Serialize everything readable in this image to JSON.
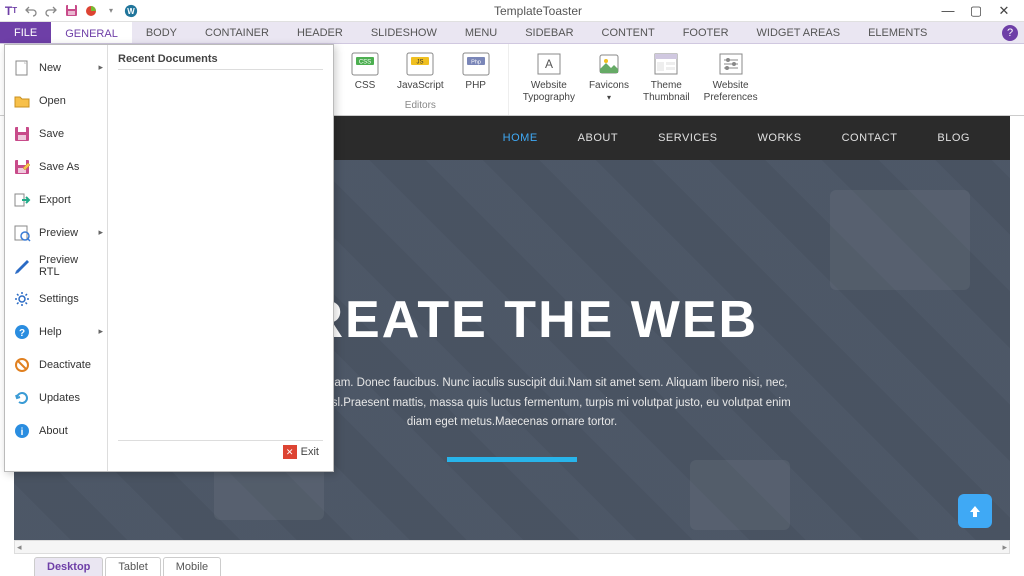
{
  "app": {
    "title": "TemplateToaster"
  },
  "ribbon": {
    "tabs": [
      "FILE",
      "GENERAL",
      "BODY",
      "CONTAINER",
      "HEADER",
      "SLIDESHOW",
      "MENU",
      "SIDEBAR",
      "CONTENT",
      "FOOTER",
      "WIDGET AREAS",
      "ELEMENTS"
    ],
    "activeTab": "GENERAL",
    "editors": {
      "label": "Editors",
      "css": "CSS",
      "js": "JavaScript",
      "php": "PHP"
    },
    "buttons": {
      "typography": "Website\nTypography",
      "favicons": "Favicons",
      "thumbnail": "Theme\nThumbnail",
      "preferences": "Website\nPreferences"
    }
  },
  "fileMenu": {
    "items": [
      {
        "label": "New",
        "hasSub": true
      },
      {
        "label": "Open",
        "hasSub": false
      },
      {
        "label": "Save",
        "hasSub": false
      },
      {
        "label": "Save As",
        "hasSub": false
      },
      {
        "label": "Export",
        "hasSub": false
      },
      {
        "label": "Preview",
        "hasSub": true
      },
      {
        "label": "Preview RTL",
        "hasSub": false
      },
      {
        "label": "Settings",
        "hasSub": false
      },
      {
        "label": "Help",
        "hasSub": true
      },
      {
        "label": "Deactivate",
        "hasSub": false
      },
      {
        "label": "Updates",
        "hasSub": false
      },
      {
        "label": "About",
        "hasSub": false
      }
    ],
    "recentTitle": "Recent Documents",
    "exit": "Exit"
  },
  "preview": {
    "nav": [
      "HOME",
      "ABOUT",
      "SERVICES",
      "WORKS",
      "CONTACT",
      "BLOG"
    ],
    "navActive": "HOME",
    "heroTitle": "CREATE THE WEB",
    "heroText": "s est.Quisque aliquam. Donec faucibus. Nunc iaculis suscipit dui.Nam sit amet sem. Aliquam libero nisi, nec, gravida vehicula, nisl.Praesent mattis, massa quis luctus fermentum, turpis mi volutpat justo, eu volutpat enim diam eget metus.Maecenas ornare tortor."
  },
  "viewTabs": {
    "items": [
      "Desktop",
      "Tablet",
      "Mobile"
    ],
    "active": "Desktop"
  }
}
